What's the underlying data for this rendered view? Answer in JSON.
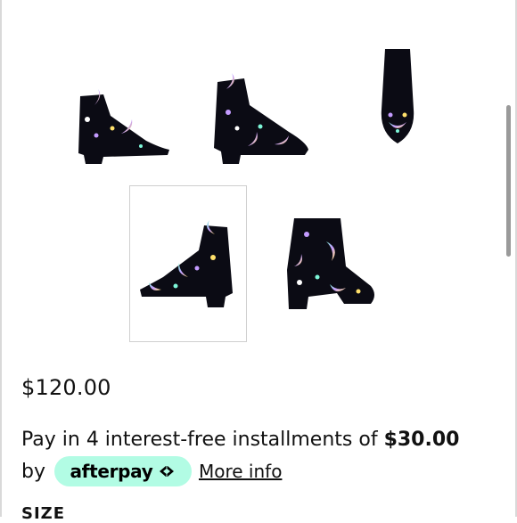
{
  "product": {
    "price": "$120.00",
    "installments_text": "Pay in 4 interest-free installments of ",
    "installment_amount": "$30.00",
    "by_text": "by",
    "afterpay_label": "afterpay",
    "more_info": "More info",
    "size_label": "SIZE"
  },
  "gallery": {
    "images": [
      {
        "view": "side-left"
      },
      {
        "view": "three-quarter"
      },
      {
        "view": "front"
      },
      {
        "view": "side-right",
        "selected": true
      },
      {
        "view": "back"
      }
    ]
  },
  "colors": {
    "afterpay_mint": "#b2fce4",
    "boot": "#0b0b14",
    "moon_gradient": [
      "#7ef7d9",
      "#c49bff",
      "#ffe06b"
    ]
  }
}
